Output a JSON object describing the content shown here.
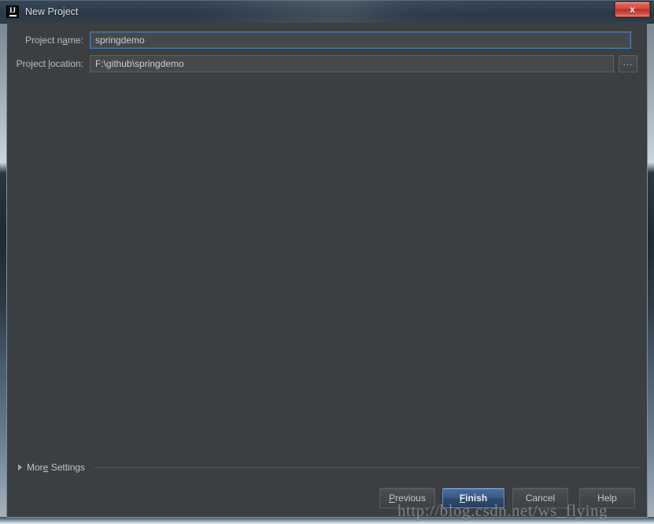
{
  "window": {
    "title": "New Project",
    "app_icon": "intellij-idea-icon",
    "app_icon_text": "IJ",
    "close_label": "x",
    "colors": {
      "titlebar": "#2b3946",
      "dialog_background": "#3c3f41",
      "field_background": "#45494a",
      "focus_border": "#4b7bb5",
      "default_button": "#3c5c86",
      "close_button": "#d6473c",
      "label_text": "#bbbbbb"
    }
  },
  "form": {
    "fields": [
      {
        "label_before": "Project n",
        "label_mnemonic": "a",
        "label_after": "me:",
        "value": "springdemo",
        "focused": true,
        "has_browse": false
      },
      {
        "label_before": "Project ",
        "label_mnemonic": "l",
        "label_after": "ocation:",
        "value": "F:\\github\\springdemo",
        "focused": false,
        "has_browse": true,
        "browse_label": "..."
      }
    ]
  },
  "more_settings": {
    "label_before": "Mor",
    "label_mnemonic": "e",
    "label_after": " Settings",
    "expanded": false,
    "chevron_icon": "triangle-right-icon"
  },
  "footer": {
    "buttons": [
      {
        "label_before": "",
        "label_mnemonic": "P",
        "label_after": "revious",
        "default": false
      },
      {
        "label_before": "",
        "label_mnemonic": "F",
        "label_after": "inish",
        "default": true
      },
      {
        "label_before": "Cancel",
        "label_mnemonic": "",
        "label_after": "",
        "default": false
      },
      {
        "label_before": "Help",
        "label_mnemonic": "",
        "label_after": "",
        "default": false
      }
    ]
  },
  "watermark": {
    "text": "http://blog.csdn.net/ws_flying"
  }
}
